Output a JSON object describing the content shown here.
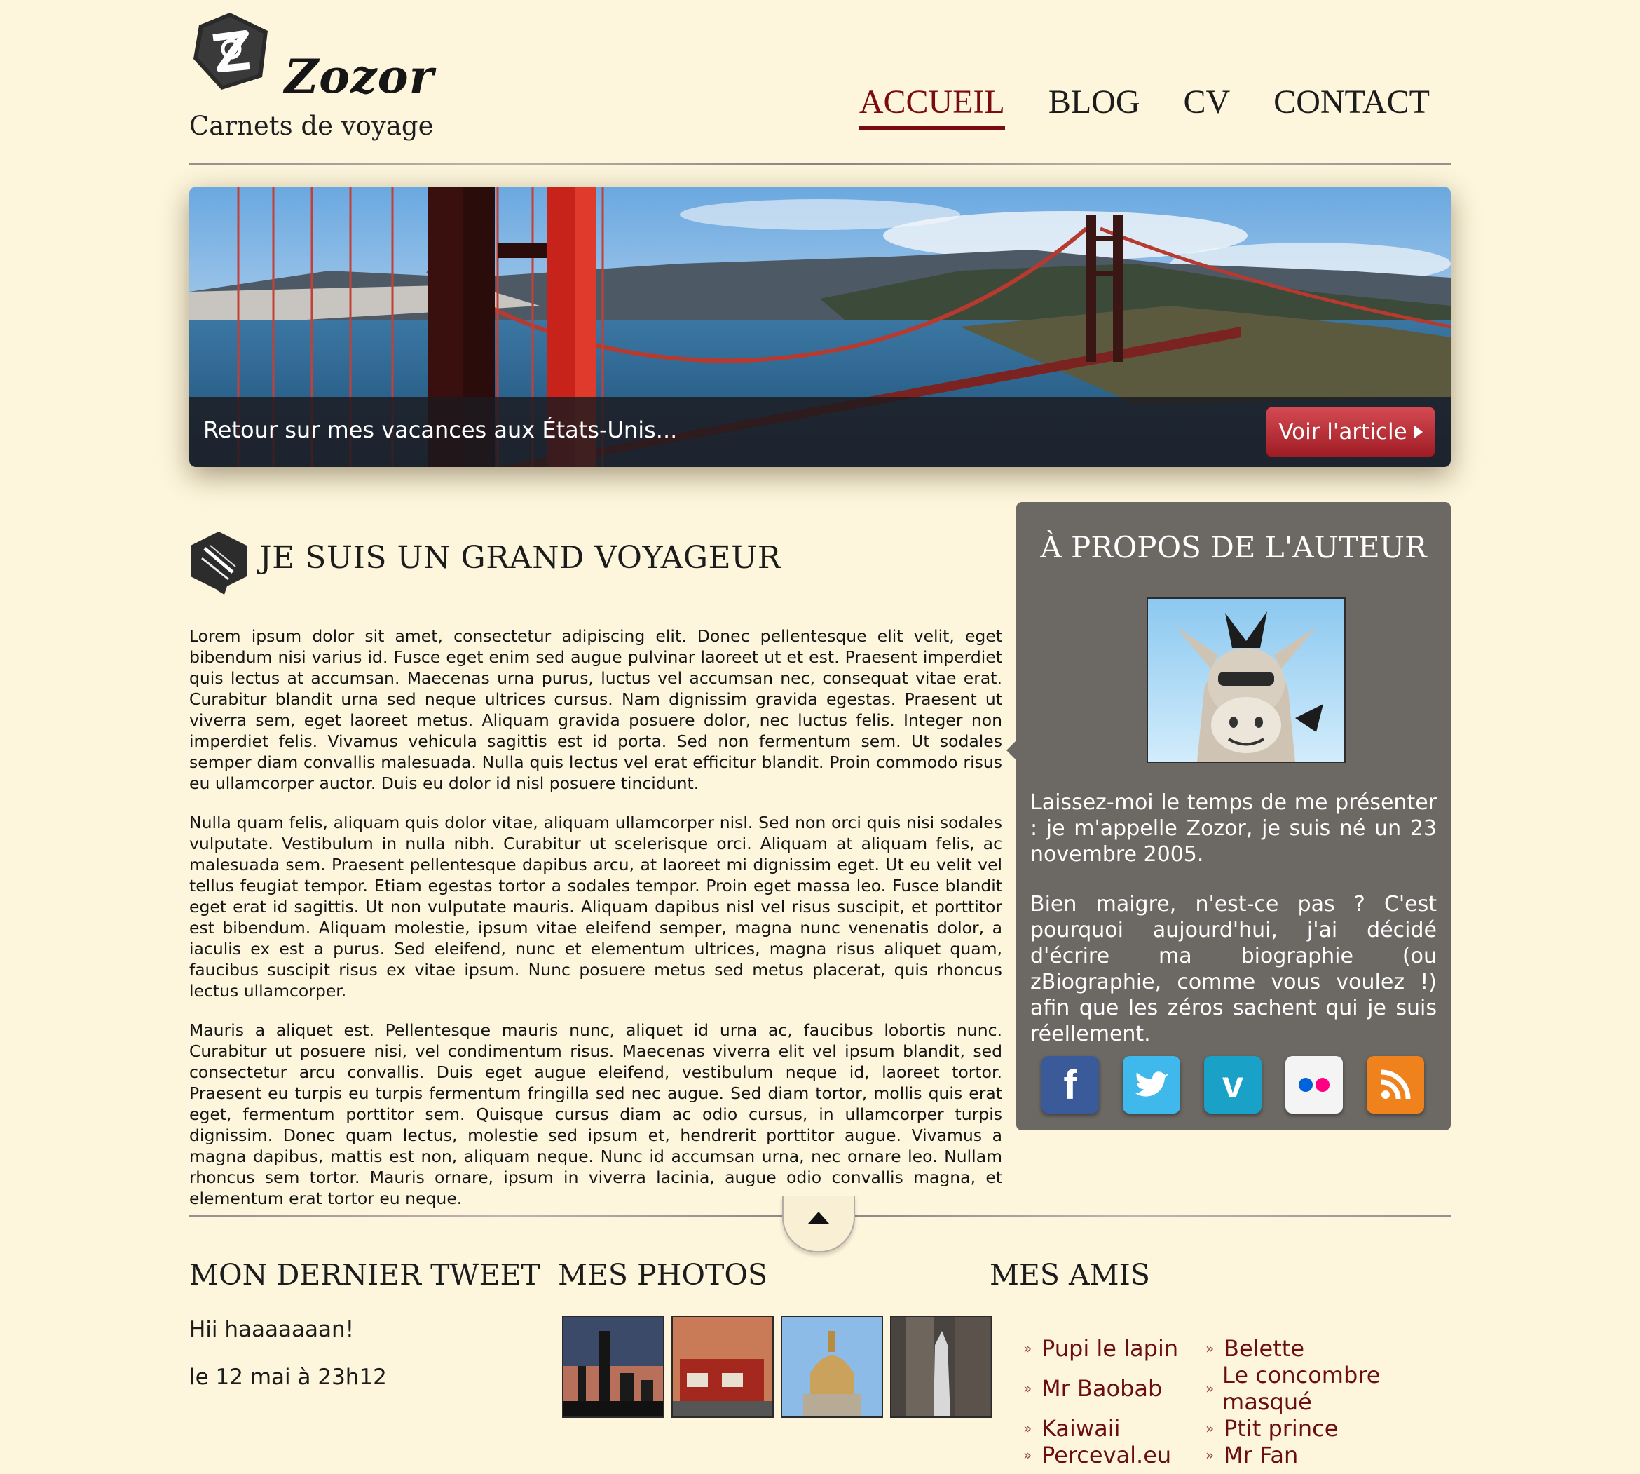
{
  "header": {
    "site_name": "Zozor",
    "tagline": "Carnets de voyage",
    "nav": [
      "ACCUEIL",
      "BLOG",
      "CV",
      "CONTACT"
    ],
    "active_nav": "ACCUEIL"
  },
  "hero": {
    "caption": "Retour sur mes vacances aux États-Unis...",
    "button_label": "Voir l'article"
  },
  "main": {
    "section_title": "JE SUIS UN GRAND VOYAGEUR",
    "paragraphs": [
      "Lorem ipsum dolor sit amet, consectetur adipiscing elit. Donec pellentesque elit velit, eget bibendum nisi varius id. Fusce eget enim sed augue pulvinar laoreet ut et est. Praesent imperdiet quis lectus at accumsan. Maecenas urna purus, luctus vel accumsan nec, consequat vitae erat. Curabitur blandit urna sed neque ultrices cursus. Nam dignissim gravida egestas. Praesent ut viverra sem, eget laoreet metus. Aliquam gravida posuere dolor, nec luctus felis. Integer non imperdiet felis. Vivamus vehicula sagittis est id porta. Sed non fermentum sem. Ut sodales semper diam convallis malesuada. Nulla quis lectus vel erat efficitur blandit. Proin commodo risus eu ullamcorper auctor. Duis eu dolor id nisl posuere tincidunt.",
      "Nulla quam felis, aliquam quis dolor vitae, aliquam ullamcorper nisl. Sed non orci quis nisi sodales vulputate. Vestibulum in nulla nibh. Curabitur ut scelerisque orci. Aliquam at aliquam felis, ac malesuada sem. Praesent pellentesque dapibus arcu, at laoreet mi dignissim eget. Ut eu velit vel tellus feugiat tempor. Etiam egestas tortor a sodales tempor. Proin eget massa leo. Fusce blandit eget erat id sagittis. Ut non vulputate mauris. Aliquam dapibus nisl vel risus suscipit, et porttitor est bibendum. Aliquam molestie, ipsum vitae eleifend semper, magna nunc venenatis dolor, a iaculis ex est a purus. Sed eleifend, nunc et elementum ultrices, magna risus aliquet quam, faucibus suscipit risus ex vitae ipsum. Nunc posuere metus sed metus placerat, quis rhoncus lectus ullamcorper.",
      "Mauris a aliquet est. Pellentesque mauris nunc, aliquet id urna ac, faucibus lobortis nunc. Curabitur ut posuere nisi, vel condimentum risus. Maecenas viverra elit vel ipsum blandit, sed consectetur arcu convallis. Duis eget augue eleifend, vestibulum neque id, laoreet tortor. Praesent eu turpis eu turpis fermentum fringilla sed nec augue. Sed diam tortor, mollis quis erat eget, fermentum porttitor sem. Quisque cursus diam ac odio cursus, in ullamcorper turpis dignissim. Donec quam lectus, molestie sed ipsum et, hendrerit porttitor augue. Vivamus a magna dapibus, mattis est non, aliquam neque. Nunc id accumsan urna, nec ornare leo. Nullam rhoncus sem tortor. Mauris ornare, ipsum in viverra lacinia, augue odio convallis magna, et elementum erat tortor eu neque."
    ]
  },
  "aside": {
    "title": "À PROPOS DE L'AUTEUR",
    "paragraphs": [
      "Laissez-moi le temps de me présenter : je m'appelle Zozor, je suis né un 23 novembre 2005.",
      "Bien maigre, n'est-ce pas ? C'est pourquoi aujourd'hui, j'ai décidé d'écrire ma biographie (ou zBiographie, comme vous voulez !) afin que les zéros sachent qui je suis réellement."
    ],
    "socials": [
      {
        "icon": "facebook-icon",
        "color": "#3b5a9a"
      },
      {
        "icon": "twitter-icon",
        "color": "#3fb8ec"
      },
      {
        "icon": "vimeo-icon",
        "color": "#1aa1c8"
      },
      {
        "icon": "flickr-icon",
        "color": "#f4f4f4"
      },
      {
        "icon": "rss-icon",
        "color": "#f0821e"
      }
    ]
  },
  "footer": {
    "tweet_title": "MON DERNIER TWEET",
    "tweet_text": "Hii haaaaaaan!",
    "tweet_date": "le 12 mai à 23h12",
    "photos_title": "MES PHOTOS",
    "friends_title": "MES AMIS",
    "friends": [
      "Pupi le lapin",
      "Belette",
      "Mr Baobab",
      "Le concombre masqué",
      "Kaiwaii",
      "Ptit prince",
      "Perceval.eu",
      "Mr Fan"
    ]
  },
  "colors": {
    "background": "#fdf6dc",
    "accent": "#7a0c10",
    "aside_bg": "#6c6864",
    "button": "#b52d35"
  }
}
